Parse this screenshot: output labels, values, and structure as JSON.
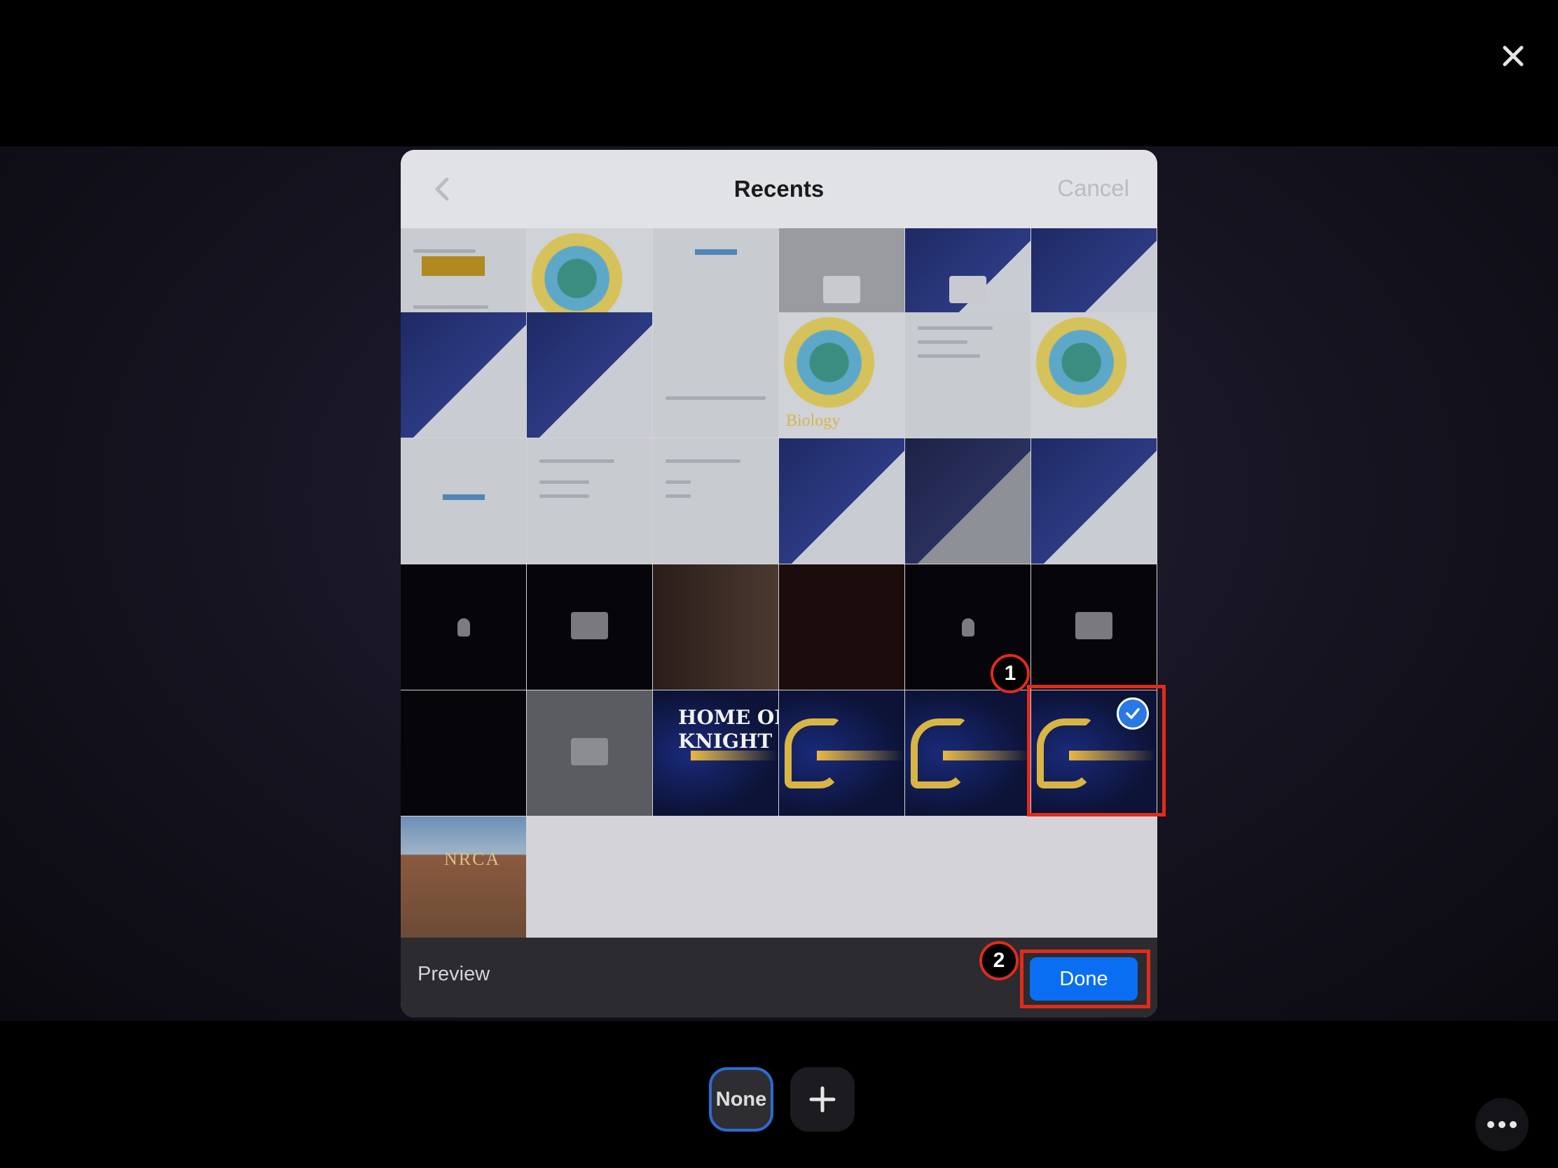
{
  "picker": {
    "title": "Recents",
    "cancel_label": "Cancel",
    "preview_label": "Preview",
    "done_label": "Done"
  },
  "thumbnails": {
    "biology_caption": "Biology",
    "home_caption": "HOME OF T\nKNIGHT",
    "nrca_caption": "NRCA"
  },
  "annotations": {
    "step1": "1",
    "step2": "2"
  },
  "bottom_bar": {
    "none_label": "None"
  },
  "colors": {
    "accent": "#0a6ef2",
    "highlight": "#e22b1c",
    "selected_check": "#2a78e4"
  },
  "icons": {
    "close": "close-icon",
    "back": "chevron-left-icon",
    "check": "checkmark-icon",
    "add": "plus-icon",
    "more": "ellipsis-icon"
  }
}
